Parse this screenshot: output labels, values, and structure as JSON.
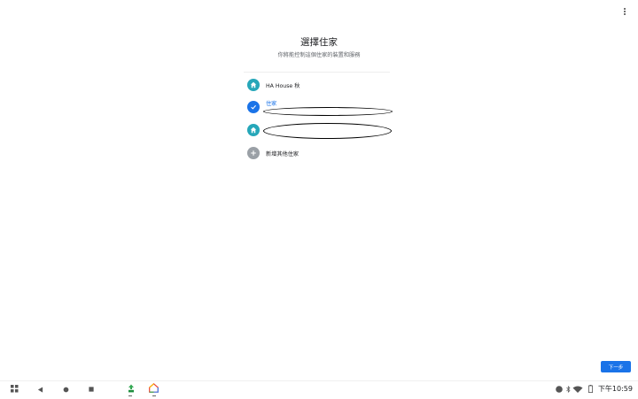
{
  "header": {
    "title": "選擇住家",
    "subtitle": "你將能控制這個住家的裝置和服務"
  },
  "homes": [
    {
      "label": "HA House 秋",
      "icon": "home-icon",
      "state": "unselected"
    },
    {
      "label": "住家",
      "icon": "check-icon",
      "state": "selected"
    },
    {
      "label": "",
      "icon": "home-icon",
      "state": "unselected"
    },
    {
      "label": "新增其他住家",
      "icon": "add-icon",
      "state": "action"
    }
  ],
  "footer": {
    "next_label": "下一步"
  },
  "status_bar": {
    "time": "下午10:59"
  },
  "colors": {
    "accent": "#1a73e8",
    "home_icon": "#26a7b9",
    "add_icon": "#9aa0a6"
  }
}
